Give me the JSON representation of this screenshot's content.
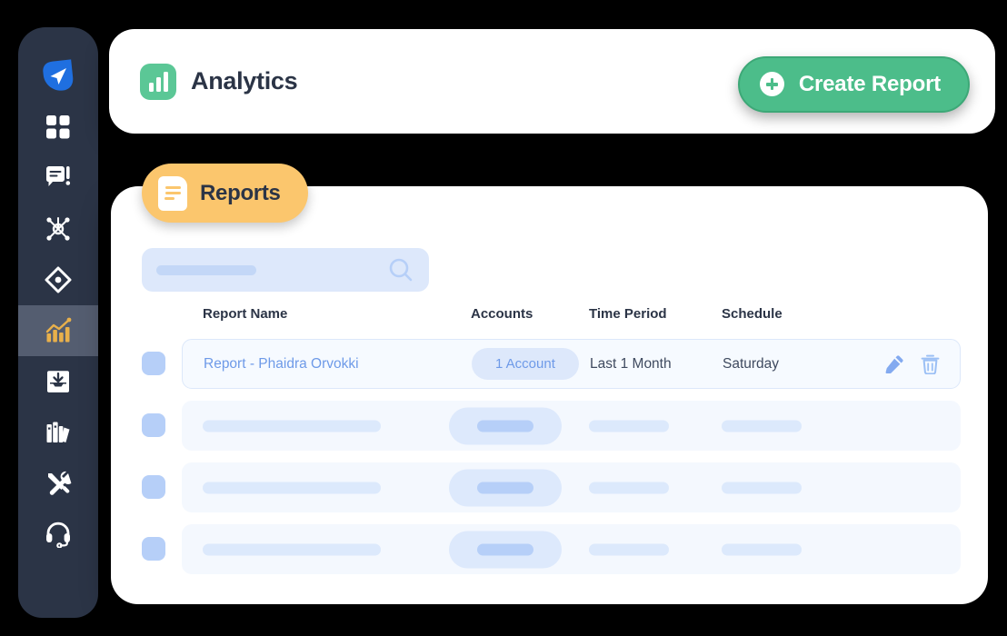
{
  "colors": {
    "sidebar_bg": "#2b3446",
    "sidebar_active_bg": "#545d70",
    "sidebar_active_icon": "#e8b04b",
    "accent_green": "#4cbd8a",
    "badge_green": "#5bc796",
    "accent_orange": "#fbc66d",
    "link_blue": "#6e9ae8",
    "skeleton_blue": "#dce9fc",
    "checkbox_blue": "#b6cff8",
    "row_bg": "#f4f8fe",
    "search_bg": "#dde8fb"
  },
  "sidebar": {
    "items": [
      {
        "icon": "paper-plane-logo-icon",
        "label": "Home",
        "active": false
      },
      {
        "icon": "dashboard-grid-icon",
        "label": "Dashboard",
        "active": false
      },
      {
        "icon": "chat-alert-icon",
        "label": "Messages",
        "active": false
      },
      {
        "icon": "network-nodes-icon",
        "label": "Network",
        "active": false
      },
      {
        "icon": "compass-diamond-icon",
        "label": "Discover",
        "active": false
      },
      {
        "icon": "bar-chart-trend-icon",
        "label": "Analytics",
        "active": true
      },
      {
        "icon": "inbox-download-icon",
        "label": "Inbox",
        "active": false
      },
      {
        "icon": "library-books-icon",
        "label": "Library",
        "active": false
      },
      {
        "icon": "tools-wrench-icon",
        "label": "Tools",
        "active": false
      },
      {
        "icon": "headset-support-icon",
        "label": "Support",
        "active": false
      }
    ]
  },
  "header": {
    "icon": "bar-chart-badge-icon",
    "title": "Analytics",
    "create_button": {
      "icon": "plus-circle-icon",
      "label": "Create Report"
    }
  },
  "tab": {
    "icon": "document-icon",
    "label": "Reports"
  },
  "search": {
    "icon": "search-icon",
    "value": "",
    "placeholder": ""
  },
  "table": {
    "columns": [
      "Report Name",
      "Accounts",
      "Time Period",
      "Schedule"
    ],
    "rows": [
      {
        "loaded": true,
        "selected": false,
        "name": "Report - Phaidra Orvokki",
        "accounts": "1 Account",
        "time_period": "Last 1 Month",
        "schedule": "Saturday",
        "actions": [
          "edit-icon",
          "delete-icon"
        ]
      },
      {
        "loaded": false,
        "selected": false,
        "name": "",
        "accounts": "",
        "time_period": "",
        "schedule": ""
      },
      {
        "loaded": false,
        "selected": false,
        "name": "",
        "accounts": "",
        "time_period": "",
        "schedule": ""
      },
      {
        "loaded": false,
        "selected": false,
        "name": "",
        "accounts": "",
        "time_period": "",
        "schedule": ""
      }
    ]
  }
}
